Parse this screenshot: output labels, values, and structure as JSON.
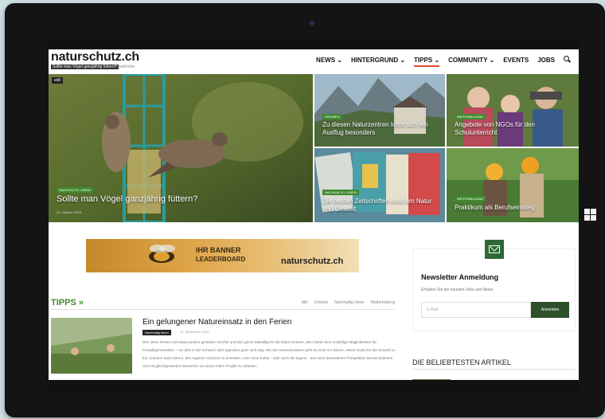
{
  "site": {
    "logo": "naturschutz.ch",
    "tagline": "Sollte man Vögel ganzjährig füttern?",
    "tagline_sub": "Umwelttricks"
  },
  "nav": {
    "items": [
      "NEWS ⌄",
      "HINTERGRUND ⌄",
      "TIPPS ⌄",
      "COMMUNITY ⌄",
      "EVENTS",
      "JOBS"
    ],
    "active_index": 2
  },
  "hero": {
    "edit_label": "edit",
    "main": {
      "badge": "NACHHALTIG LEBEN",
      "title": "Sollte man Vögel ganzjährig füttern?",
      "date": "24. Oktober 2019"
    },
    "tiles": [
      {
        "badge": "ERLEBEN",
        "title": "Zu diesen Naturzentren lohnt sich ein Ausflug besonders"
      },
      {
        "badge": "WEITERBILDUNG",
        "title": "Angebote von NGOs für den Schulunterricht"
      },
      {
        "badge": "NACHHALTIG LEBEN",
        "title": "Die besten Zeitschriften rund um Natur und Umwelt"
      },
      {
        "badge": "WEITERBILDUNG",
        "title": "Praktikum als Berufseinstieg"
      }
    ]
  },
  "banner": {
    "line1": "IHR BANNER",
    "line2": "LEADERBOARD",
    "logo": "naturschutz.ch"
  },
  "tipps": {
    "title": "TIPPS »",
    "filters": [
      "Alle",
      "Erleben",
      "Nachhaltig leben",
      "Weiterbildung"
    ],
    "article": {
      "title": "Ein gelungener Natureinsatz in den Ferien",
      "badge": "Nachhaltig leben",
      "date": "17. September 2019",
      "text": "Wer seine Ferien mal etwas anders gestalten möchte und sich gerne tatkräftig für die Natur einsetzt, dem bieten sich unzählige Möglichkeiten für Freiwilligeneinsätze – sei dies in der Schweiz oder irgendwo ganz weit weg. Bei den Natureinsätzen geht es nicht nur darum, etwas Gutes für die Umwelt zu tun, sondern auch darum, den eigenen Horizont zu erweitern, eine neue Kultur - oder auch die eigene - aus einer besonderen Perspektive kennenzulernen und mit gleichgesinnten Menschen an einem tollen Projekt zu arbeiten."
    }
  },
  "newsletter": {
    "title": "Newsletter Anmeldung",
    "description": "Erhalten Sie die neusten Jobs und News.",
    "placeholder": "E-Mail",
    "button": "Anmelden"
  },
  "popular": {
    "title": "DIE BELIEBTESTEN ARTIKEL"
  },
  "colors": {
    "accent_green": "#3f8a2e",
    "dark_green": "#2d4f2a",
    "nav_active": "#e04b2c"
  }
}
